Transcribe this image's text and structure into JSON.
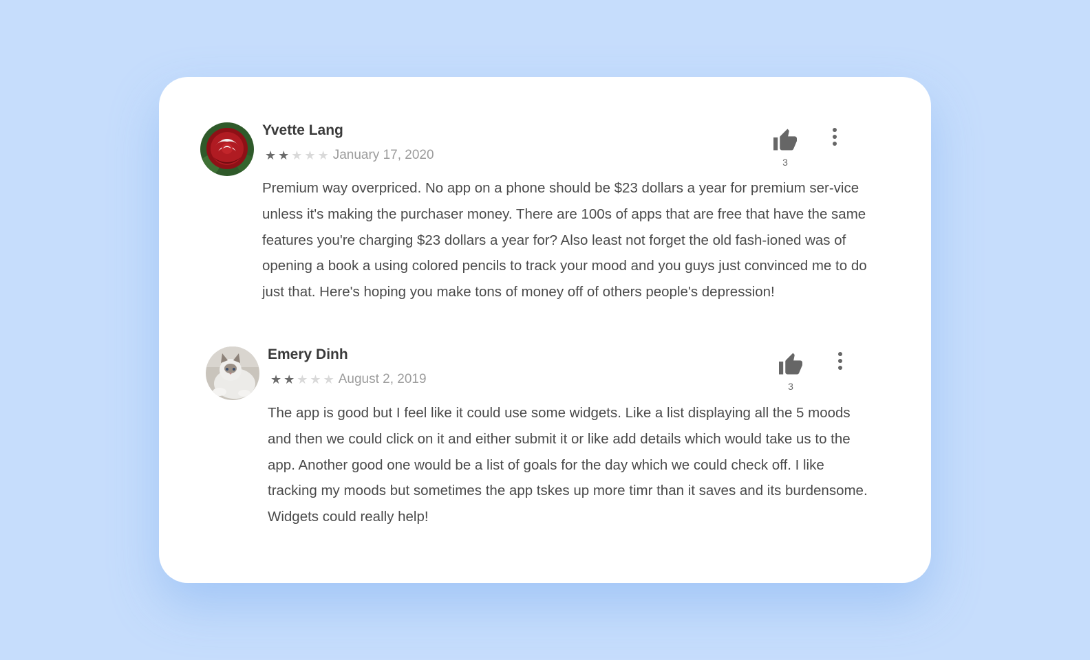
{
  "reviews": [
    {
      "author": "Yvette Lang",
      "avatar": "red-rose-photo",
      "rating": 2,
      "max_rating": 5,
      "date": "January 17, 2020",
      "text": "Premium way overpriced. No app on a phone should be $23 dollars a year for premium ser-vice unless it's making the purchaser money. There are 100s of apps that are free that have the same features you're charging $23 dollars a year for? Also least not forget the old fash-ioned was of opening a book a using colored pencils to track your mood and you guys just convinced me to do just that. Here's hoping you make tons of money off of others people's depression!",
      "likes": "3"
    },
    {
      "author": "Emery Dinh",
      "avatar": "white-cat-photo",
      "rating": 2,
      "max_rating": 5,
      "date": "August 2, 2019",
      "text": "The app is good but I feel like it could use some widgets. Like a list displaying all the 5 moods and then we could click on it and either submit it or like add details which would take us to the app. Another good one would be a list of goals for the day which we could check off. I like tracking my moods but sometimes the app tskes up more timr than it saves and its burdensome. Widgets could really help!",
      "likes": "3"
    }
  ],
  "icons": {
    "like": "thumbs-up-icon",
    "menu": "more-vert-icon",
    "star": "star-icon"
  },
  "colors": {
    "background": "#c6ddfc",
    "card": "#ffffff",
    "star_filled": "#6a6a6a",
    "star_empty": "#d9d9d9"
  }
}
